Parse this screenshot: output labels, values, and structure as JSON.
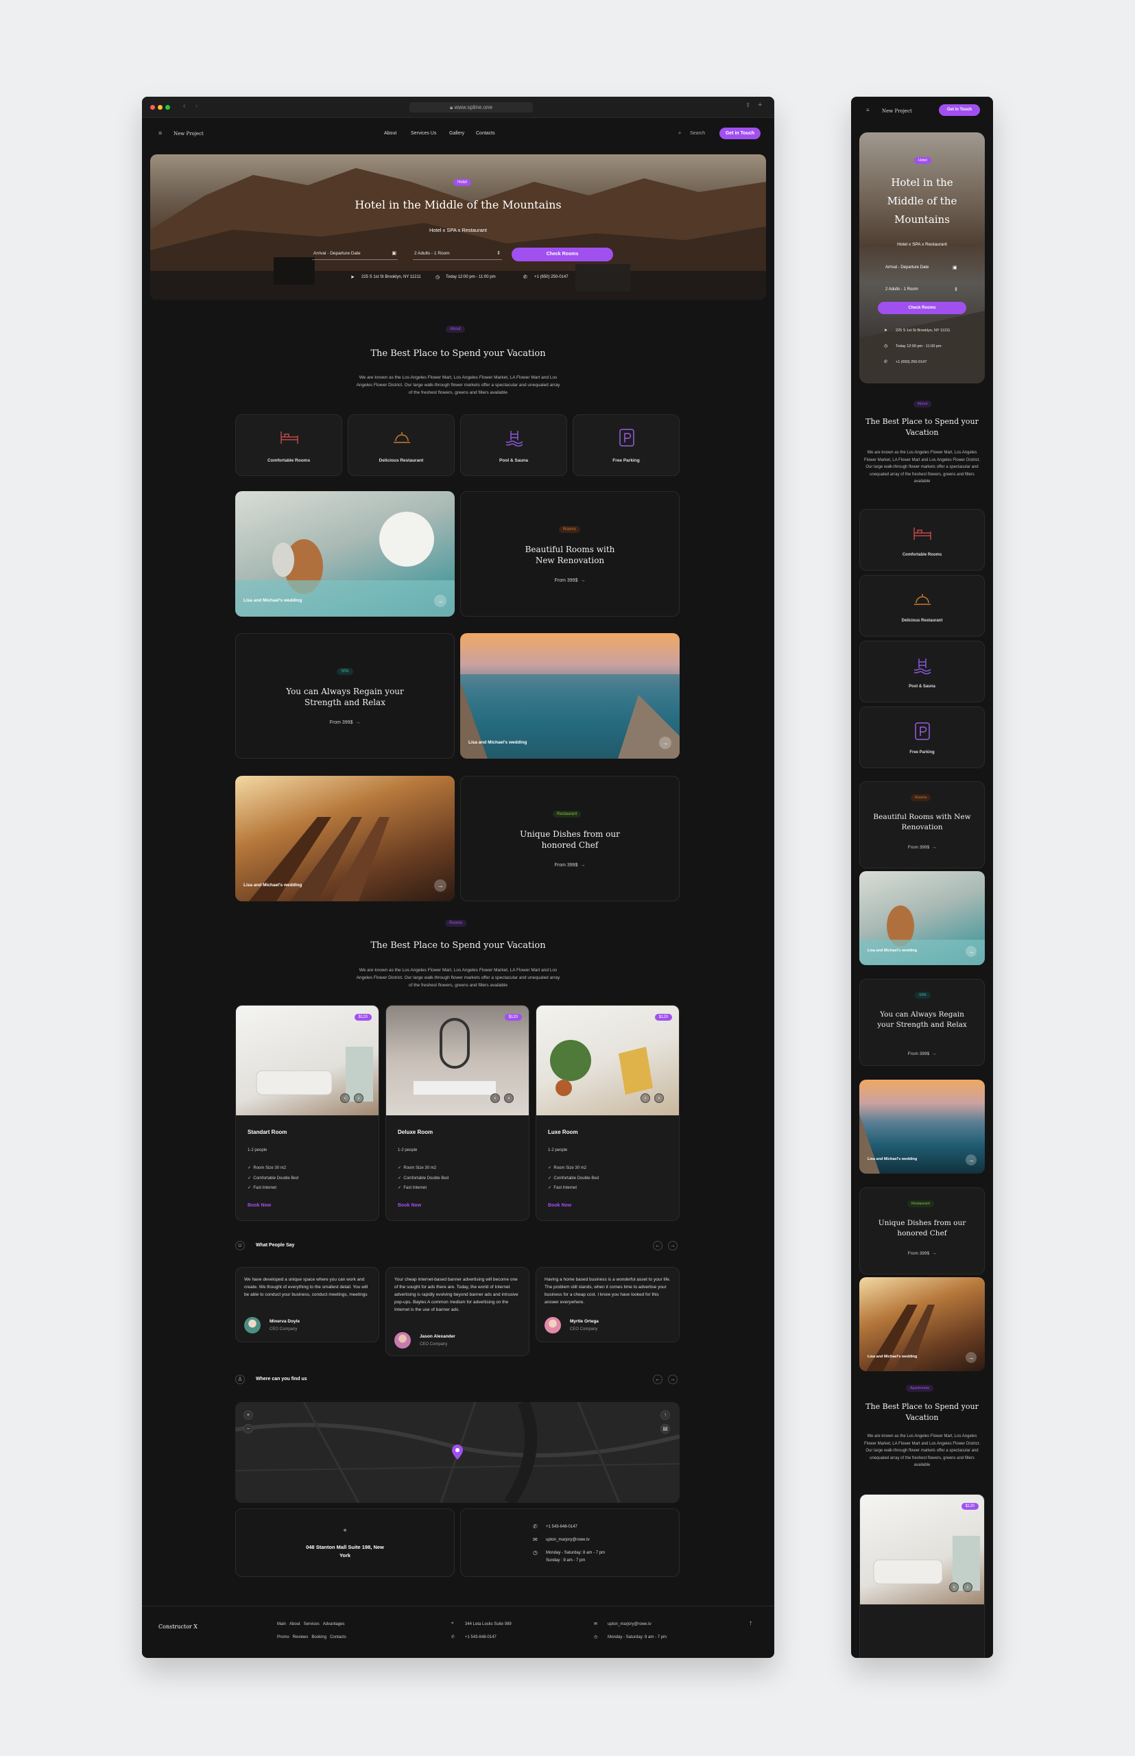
{
  "browser": {
    "url": "www.spline.one"
  },
  "nav": {
    "project": "New Project",
    "links": [
      "About",
      "Services Us",
      "Gallery",
      "Contacts"
    ],
    "search": "Search",
    "cta": "Get in Touch"
  },
  "hero": {
    "chip": "Hotel",
    "title": "Hotel in the Middle of the Mountains",
    "subtitle": "Hotel x SPA x Restaurant",
    "date_field": "Arrival - Departure Date",
    "guests_field": "2 Adults - 1 Room",
    "check_button": "Check Rooms",
    "address": "225 S 1st St Brooklyn, NY 11211",
    "hours": "Today 12:00 pm - 11:00 pm",
    "phone": "+1 (650) 250-0147"
  },
  "intro": {
    "chip": "About",
    "title": "The Best Place to Spend your Vacation",
    "text": "We are known as the Los Angeles Flower Mart, Los Angeles Flower Market, LA Flower Mart and Los Angeles Flower District. Our large walk-through flower markets offer a spectacular and unequaled array of the freshest flowers, greens and fillers available"
  },
  "features": [
    "Comfortable Rooms",
    "Delicious Restaurant",
    "Pool & Sauna",
    "Free Parking"
  ],
  "blocks": [
    {
      "chip": "Rooms",
      "title": "Beautiful Rooms with New Renovation",
      "from": "From 399$",
      "caption": "Lisa and Michael's wedding"
    },
    {
      "chip": "SPA",
      "title": "You can Always Regain your Strength and Relax",
      "from": "From 399$",
      "caption": "Lisa and Michael's wedding"
    },
    {
      "chip": "Restaurant",
      "title": "Unique Dishes from our honored Chef",
      "from": "From 399$",
      "caption": "Lisa and Michael's wedding"
    }
  ],
  "apartments": {
    "chip": "Apartments",
    "chip_short": "Rooms",
    "title": "The Best Place to Spend your Vacation",
    "text": "We are known as the Los Angeles Flower Mart, Los Angeles Flower Market, LA Flower Mart and Los Angeles Flower District. Our large walk-through flower markets offer a spectacular and unequaled array of the freshest flowers, greens and fillers available",
    "rooms": [
      {
        "name": "Standart Room",
        "people": "1-2 people",
        "price": "$120",
        "features": [
          "Room Size 30 m2",
          "Comfortable Double Bed",
          "Fast Internet"
        ],
        "book": "Book Now"
      },
      {
        "name": "Deluxe Room",
        "people": "1-2 people",
        "price": "$120",
        "features": [
          "Room Size 30 m2",
          "Comfortable Double Bed",
          "Fast Internet"
        ],
        "book": "Book Now"
      },
      {
        "name": "Luxe Room",
        "people": "1-2 people",
        "price": "$120",
        "features": [
          "Room Size 30 m2",
          "Comfortable Double Bed",
          "Fast Internet"
        ],
        "book": "Book Now"
      }
    ]
  },
  "testimonials": {
    "title": "What People Say",
    "items": [
      {
        "text": "We have developed a unique space where you can work and create. We thought of everything to the smallest detail. You will be able to conduct your business, conduct meetings, meetings",
        "name": "Minerva Doyle",
        "company": "CEO Company"
      },
      {
        "text": "Your cheap internet-based banner advertising will become one of the sought for ads there are. Today, the world of Internet advertising is rapidly evolving beyond banner ads and intrusive pop-ups. Bayles A common medium for advertising on the Internet is the use of banner ads.",
        "name": "Jason Alexander",
        "company": "CEO Company"
      },
      {
        "text": "Having a home based business is a wonderful asset to your life. The problem still stands, when it comes time to advertise your business for a cheap cost. I know you have looked for this answer everywhere.",
        "name": "Myrtle Ortega",
        "company": "CEO Company"
      }
    ]
  },
  "location": {
    "title": "Where can you find us",
    "address": "048 Stanton Mall Suite 198, New York",
    "phone": "+1 543-648-0147",
    "email": "upton_marjory@rowe.tv",
    "hours1": "Monday - Saturday: 8 am - 7 pm",
    "hours2": "Sunday : 9 am - 7 pm"
  },
  "footer": {
    "brand": "Constructor X",
    "links1": [
      "Main",
      "About",
      "Services",
      "Advantages"
    ],
    "links2": [
      "Promo",
      "Reviews",
      "Booking",
      "Contacts"
    ],
    "address": "344 Leta Locks Suite 089",
    "phone": "+1 543-648-0147",
    "email": "upton_marjory@rowe.tv",
    "hours": "Monday - Saturday: 8 am - 7 pm"
  },
  "colors": {
    "accent": "#a150f0",
    "bg": "#141414"
  }
}
